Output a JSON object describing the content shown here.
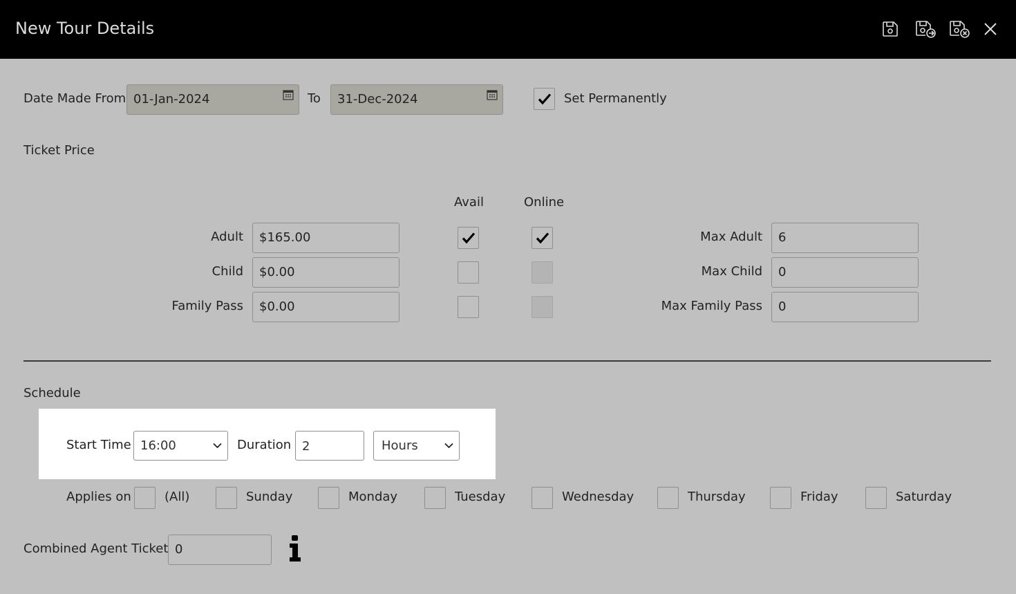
{
  "header": {
    "title": "New Tour Details",
    "icons": [
      "save-icon",
      "save-and-new-icon",
      "save-and-close-icon",
      "close-icon"
    ]
  },
  "dates": {
    "from_label": "Date Made From",
    "from_value": "01-Jan-2024",
    "to_label": "To",
    "to_value": "31-Dec-2024",
    "set_permanently_label": "Set Permanently",
    "set_permanently_checked": true
  },
  "ticket_price": {
    "section_label": "Ticket Price",
    "avail_header": "Avail",
    "online_header": "Online",
    "rows": [
      {
        "label": "Adult",
        "price": "$165.00",
        "avail": true,
        "online": true,
        "online_enabled": true,
        "max_label": "Max Adult",
        "max_value": "6"
      },
      {
        "label": "Child",
        "price": "$0.00",
        "avail": false,
        "online": false,
        "online_enabled": false,
        "max_label": "Max Child",
        "max_value": "0"
      },
      {
        "label": "Family Pass",
        "price": "$0.00",
        "avail": false,
        "online": false,
        "online_enabled": false,
        "max_label": "Max Family Pass",
        "max_value": "0"
      }
    ]
  },
  "schedule": {
    "section_label": "Schedule",
    "start_time_label": "Start Time",
    "start_time_value": "16:00",
    "duration_label": "Duration",
    "duration_value": "2",
    "duration_unit": "Hours",
    "applies_on_label": "Applies on",
    "days": [
      {
        "label": "(All)",
        "checked": false
      },
      {
        "label": "Sunday",
        "checked": false
      },
      {
        "label": "Monday",
        "checked": false
      },
      {
        "label": "Tuesday",
        "checked": false
      },
      {
        "label": "Wednesday",
        "checked": false
      },
      {
        "label": "Thursday",
        "checked": false
      },
      {
        "label": "Friday",
        "checked": false
      },
      {
        "label": "Saturday",
        "checked": false
      }
    ]
  },
  "agent": {
    "label": "Combined Agent Tickets",
    "value": "0",
    "info_icon": "info-icon"
  },
  "colors": {
    "header_bg": "#000000",
    "body_bg": "#c0c0c0",
    "date_field_bg": "#a8a8a0",
    "panel_bg": "#ffffff"
  }
}
